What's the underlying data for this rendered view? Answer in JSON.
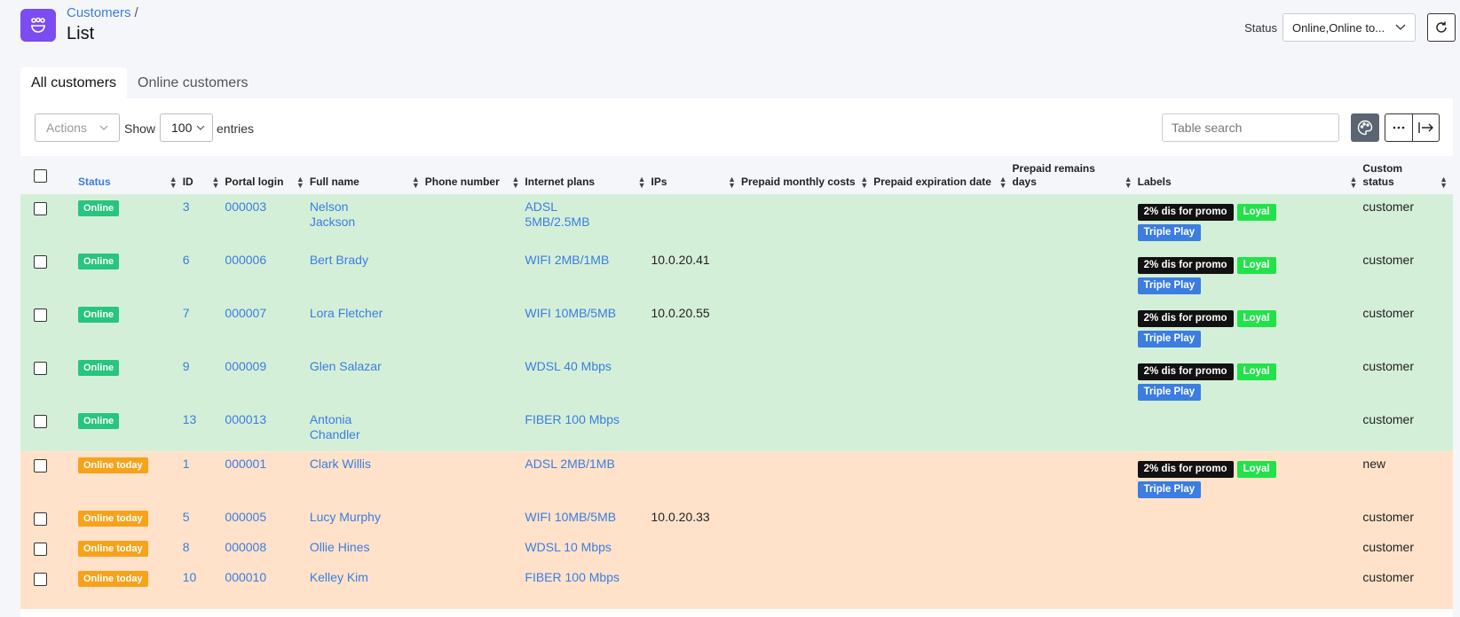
{
  "header": {
    "breadcrumb": "Customers",
    "breadcrumb_sep": "/",
    "title": "List",
    "status_label": "Status",
    "status_value": "Online,Online to..."
  },
  "tabs": [
    {
      "label": "All customers",
      "active": true
    },
    {
      "label": "Online customers",
      "active": false
    }
  ],
  "toolbar": {
    "actions_label": "Actions",
    "show_label": "Show",
    "entries_value": "100",
    "entries_label": "entries",
    "search_placeholder": "Table search"
  },
  "columns": {
    "status": "Status",
    "id": "ID",
    "portal_login": "Portal login",
    "full_name": "Full name",
    "phone": "Phone number",
    "plans": "Internet plans",
    "ips": "IPs",
    "prepaid_costs": "Prepaid monthly costs",
    "prepaid_exp": "Prepaid expiration date",
    "prepaid_days": "Prepaid remains days",
    "labels": "Labels",
    "custom_status": "Custom status"
  },
  "label_texts": {
    "promo": "2% dis for promo",
    "loyal": "Loyal",
    "triple": "Triple Play"
  },
  "rows": [
    {
      "status": "Online",
      "id": "3",
      "login": "000003",
      "name": "Nelson Jackson",
      "plan": "ADSL 5MB/2.5MB",
      "ip": "",
      "labels": true,
      "custom": "customer"
    },
    {
      "status": "Online",
      "id": "6",
      "login": "000006",
      "name": "Bert Brady",
      "plan": "WIFI 2MB/1MB",
      "ip": "10.0.20.41",
      "labels": true,
      "custom": "customer"
    },
    {
      "status": "Online",
      "id": "7",
      "login": "000007",
      "name": "Lora Fletcher",
      "plan": "WIFI 10MB/5MB",
      "ip": "10.0.20.55",
      "labels": true,
      "custom": "customer"
    },
    {
      "status": "Online",
      "id": "9",
      "login": "000009",
      "name": "Glen Salazar",
      "plan": "WDSL 40 Mbps",
      "ip": "",
      "labels": true,
      "custom": "customer"
    },
    {
      "status": "Online",
      "id": "13",
      "login": "000013",
      "name": "Antonia Chandler",
      "plan": "FIBER 100 Mbps",
      "ip": "",
      "labels": false,
      "custom": "customer"
    },
    {
      "status": "Online today",
      "id": "1",
      "login": "000001",
      "name": "Clark Willis",
      "plan": "ADSL 2MB/1MB",
      "ip": "",
      "labels": true,
      "custom": "new"
    },
    {
      "status": "Online today",
      "id": "5",
      "login": "000005",
      "name": "Lucy Murphy",
      "plan": "WIFI 10MB/5MB",
      "ip": "10.0.20.33",
      "labels": false,
      "custom": "customer"
    },
    {
      "status": "Online today",
      "id": "8",
      "login": "000008",
      "name": "Ollie Hines",
      "plan": "WDSL 10 Mbps",
      "ip": "",
      "labels": false,
      "custom": "customer"
    },
    {
      "status": "Online today",
      "id": "10",
      "login": "000010",
      "name": "Kelley Kim",
      "plan": "FIBER 100 Mbps",
      "ip": "",
      "labels": false,
      "custom": "customer"
    }
  ]
}
